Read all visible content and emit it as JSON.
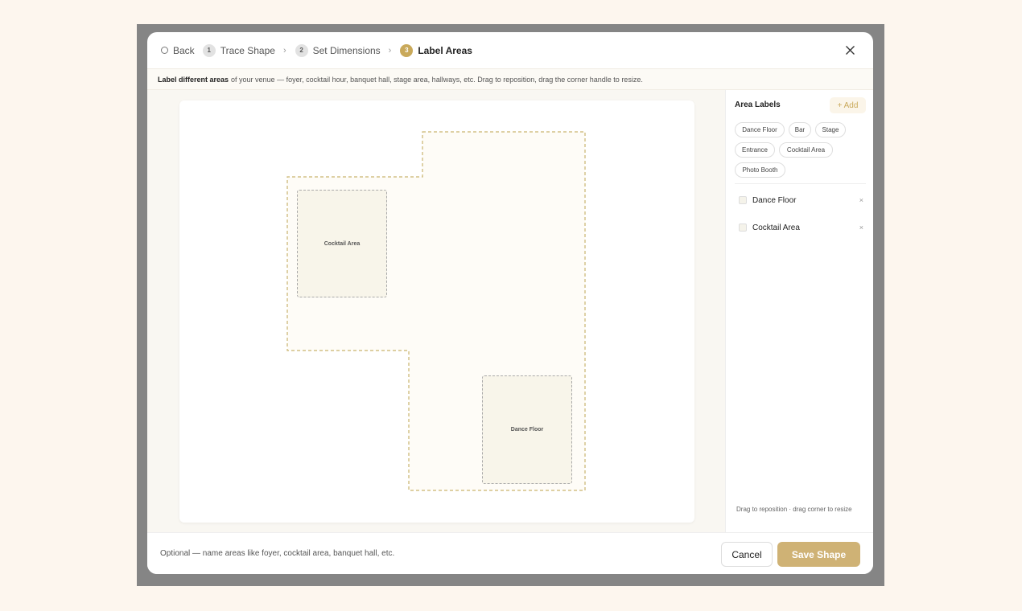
{
  "header": {
    "back_label": "Back",
    "steps": [
      {
        "num": "1",
        "label": "Trace Shape"
      },
      {
        "num": "2",
        "label": "Set Dimensions"
      },
      {
        "num": "3",
        "label": "Label Areas"
      }
    ],
    "separator": "›",
    "close_icon": "close-icon"
  },
  "instruction": {
    "bold": "Label different areas",
    "text": "of your venue — foyer, cocktail hour, banquet hall, stage area, hallways, etc. Drag to reposition, drag the corner handle to resize."
  },
  "canvas": {
    "areas": [
      {
        "label": "Cocktail Area"
      },
      {
        "label": "Dance Floor"
      }
    ]
  },
  "sidebar": {
    "title": "Area Labels",
    "add_label": "+ Add",
    "chips": [
      "Dance Floor",
      "Bar",
      "Stage",
      "Entrance",
      "Cocktail Area",
      "Photo Booth"
    ],
    "labels": [
      {
        "name": "Dance Floor",
        "remove": "×"
      },
      {
        "name": "Cocktail Area",
        "remove": "×"
      }
    ],
    "hint": "Drag to reposition · drag corner to resize"
  },
  "footer": {
    "hint": "Optional — name areas like foyer, cocktail area, banquet hall, etc.",
    "cancel_label": "Cancel",
    "save_label": "Save Shape"
  },
  "colors": {
    "accent": "#c9a95a",
    "save_button": "#cfb275",
    "overlay": "#858585",
    "page_bg": "#fdf6ee"
  }
}
